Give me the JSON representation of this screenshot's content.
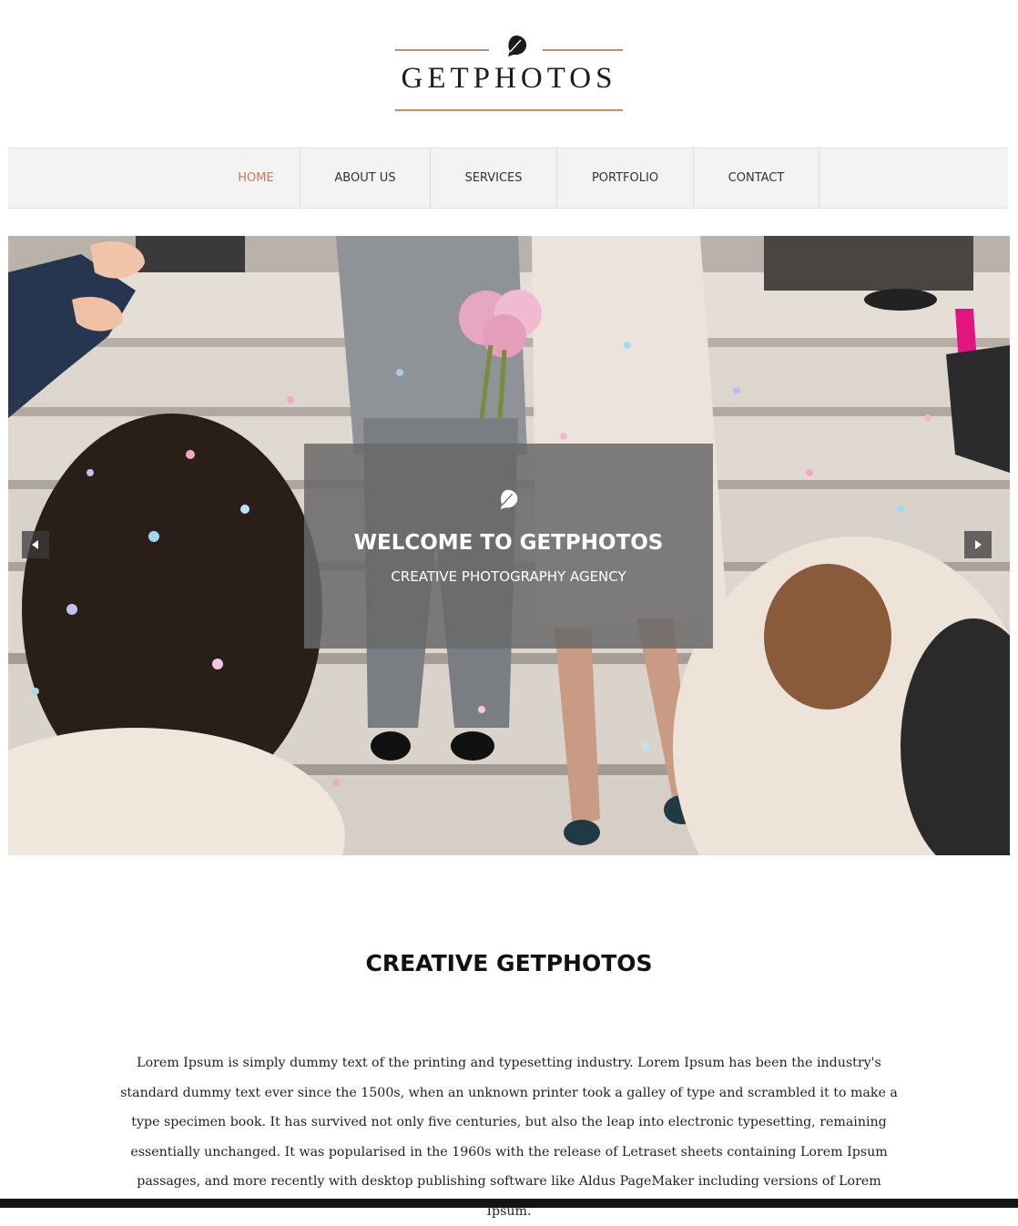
{
  "logo": {
    "text": "GETPHOTOS",
    "icon": "leaf-icon",
    "accent_color": "#c98a68"
  },
  "nav": {
    "items": [
      {
        "label": "HOME",
        "active": true
      },
      {
        "label": "ABOUT US",
        "active": false
      },
      {
        "label": "SERVICES",
        "active": false
      },
      {
        "label": "PORTFOLIO",
        "active": false
      },
      {
        "label": "CONTACT",
        "active": false
      }
    ],
    "active_color": "#c77a55"
  },
  "hero": {
    "icon": "leaf-icon",
    "title": "WELCOME TO GETPHOTOS",
    "subtitle": "CREATIVE PHOTOGRAPHY AGENCY",
    "prev_icon": "arrow-left-icon",
    "next_icon": "arrow-right-icon"
  },
  "section": {
    "title": "CREATIVE GETPHOTOS",
    "text": "Lorem Ipsum is simply dummy text of the printing and typesetting industry. Lorem Ipsum has been the industry's standard dummy text ever since the 1500s, when an unknown printer took a galley of type and scrambled it to make a type specimen book. It has survived not only five centuries, but also the leap into electronic typesetting, remaining essentially unchanged. It was popularised in the 1960s with the release of Letraset sheets containing Lorem Ipsum passages, and more recently with desktop publishing software like Aldus PageMaker including versions of Lorem Ipsum."
  }
}
